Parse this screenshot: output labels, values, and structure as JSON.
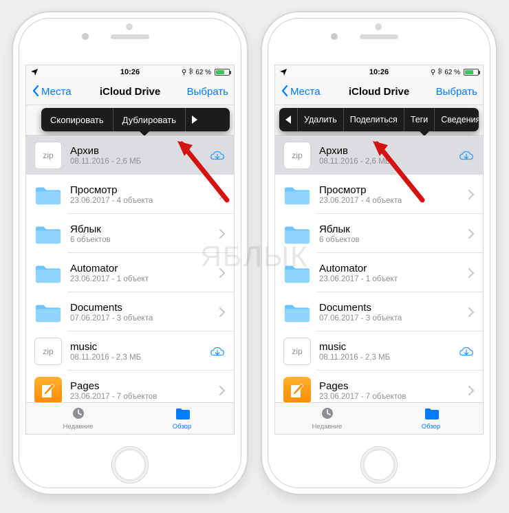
{
  "statusbar": {
    "time": "10:26",
    "battery": "62 %"
  },
  "nav": {
    "back": "Места",
    "title": "iCloud Drive",
    "select": "Выбрать"
  },
  "ctx_page1": {
    "copy": "Скопировать",
    "duplicate": "Дублировать"
  },
  "ctx_page2": {
    "delete": "Удалить",
    "share": "Поделиться",
    "tags": "Теги",
    "info": "Сведения"
  },
  "files": [
    {
      "name": "Архив",
      "sub": "08.11.2016 - 2,6 МБ",
      "kind": "zip",
      "cloud": true,
      "selected": true
    },
    {
      "name": "Просмотр",
      "sub": "23.06.2017 - 4 объекта",
      "kind": "folder",
      "badge": "preview"
    },
    {
      "name": "Яблык",
      "sub": "6 объектов",
      "kind": "folder"
    },
    {
      "name": "Automator",
      "sub": "23.06.2017 - 1 объект",
      "kind": "folder",
      "badge": "robot"
    },
    {
      "name": "Documents",
      "sub": "07.06.2017 - 3 объекта",
      "kind": "folder"
    },
    {
      "name": "music",
      "sub": "08.11.2016 - 2,3 МБ",
      "kind": "zip",
      "cloud": true
    },
    {
      "name": "Pages",
      "sub": "23.06.2017 - 7 объектов",
      "kind": "pages"
    }
  ],
  "tabs": {
    "recent": "Недавние",
    "browse": "Обзор"
  },
  "watermark": "ЯБЛЫК"
}
